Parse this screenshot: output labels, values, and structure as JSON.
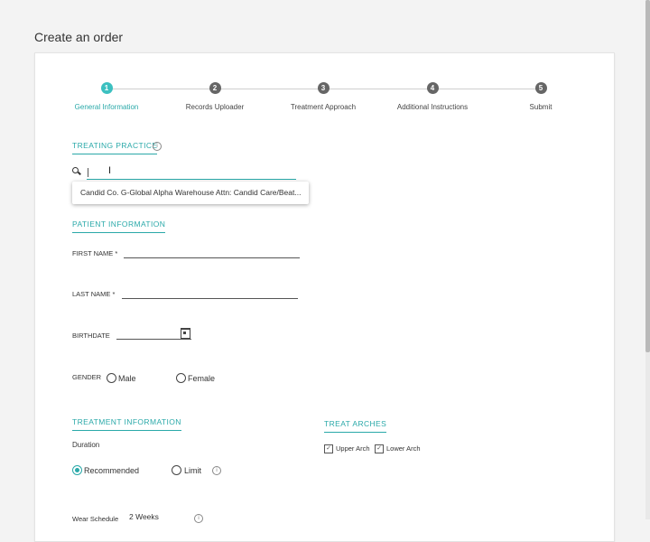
{
  "page": {
    "title": "Create an order"
  },
  "stepper": {
    "steps": [
      {
        "number": "1",
        "label": "General Information"
      },
      {
        "number": "2",
        "label": "Records Uploader"
      },
      {
        "number": "3",
        "label": "Treatment Approach"
      },
      {
        "number": "4",
        "label": "Additional Instructions"
      },
      {
        "number": "5",
        "label": "Submit"
      }
    ],
    "active_step": 1
  },
  "treating_practice": {
    "title": "TREATING PRACTICE",
    "info_icon": "info-icon",
    "search": {
      "value": "",
      "placeholder": ""
    },
    "dropdown_options": [
      "Candid Co. G-Global Alpha Warehouse Attn: Candid Care/Beat..."
    ]
  },
  "patient_information": {
    "title": "PATIENT INFORMATION",
    "first_name_label": "FIRST NAME *",
    "first_name_value": "",
    "last_name_label": "LAST NAME *",
    "last_name_value": "",
    "birthdate_label": "BIRTHDATE",
    "birthdate_value": "",
    "gender_label": "GENDER",
    "gender_options": [
      "Male",
      "Female"
    ],
    "gender_selected": null
  },
  "treatment_information": {
    "title": "TREATMENT INFORMATION",
    "duration_label": "Duration",
    "duration_options": [
      "Recommended",
      "Limit"
    ],
    "duration_selected": "Recommended",
    "wear_schedule_label": "Wear Schedule",
    "wear_schedule_value": "2 Weeks"
  },
  "treat_arches": {
    "title": "TREAT ARCHES",
    "options": [
      {
        "label": "Upper Arch",
        "checked": true
      },
      {
        "label": "Lower Arch",
        "checked": true
      }
    ]
  },
  "colors": {
    "accent": "#2aa9a9",
    "active_step": "#3cc0c0",
    "inactive_step": "#666666"
  }
}
